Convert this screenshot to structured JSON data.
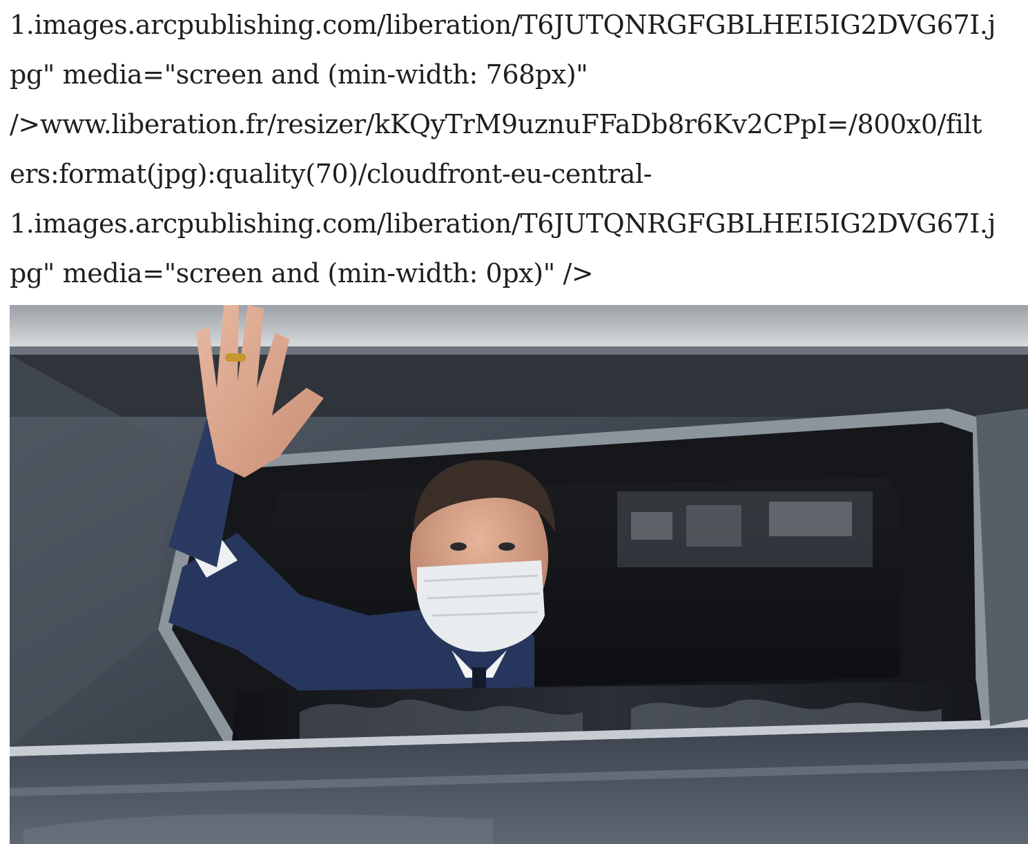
{
  "article": {
    "code_lines": [
      "1.images.arcpublishing.com/liberation/T6JUTQNRGFGBLHEI5IG2DVG67I.j",
      "pg\" media=\"screen and (min-width: 768px)\"",
      "/>www.liberation.fr/resizer/kKQyTrM9uznuFFaDb8r6Kv2CPpI=/800x0/filt",
      "ers:format(jpg):quality(70)/cloudfront-eu-central-",
      "1.images.arcpublishing.com/liberation/T6JUTQNRGFGBLHEI5IG2DVG67I.j",
      "pg\" media=\"screen and (min-width: 0px)\" />"
    ]
  },
  "colors": {
    "text": "#1f1f1f",
    "car_body": "#3a3f47",
    "window_frame": "#15171b",
    "mask": "#e9ecef",
    "suit": "#27365c",
    "skin": "#d9a58a"
  },
  "icons": {
    "photo": "news-photo"
  }
}
